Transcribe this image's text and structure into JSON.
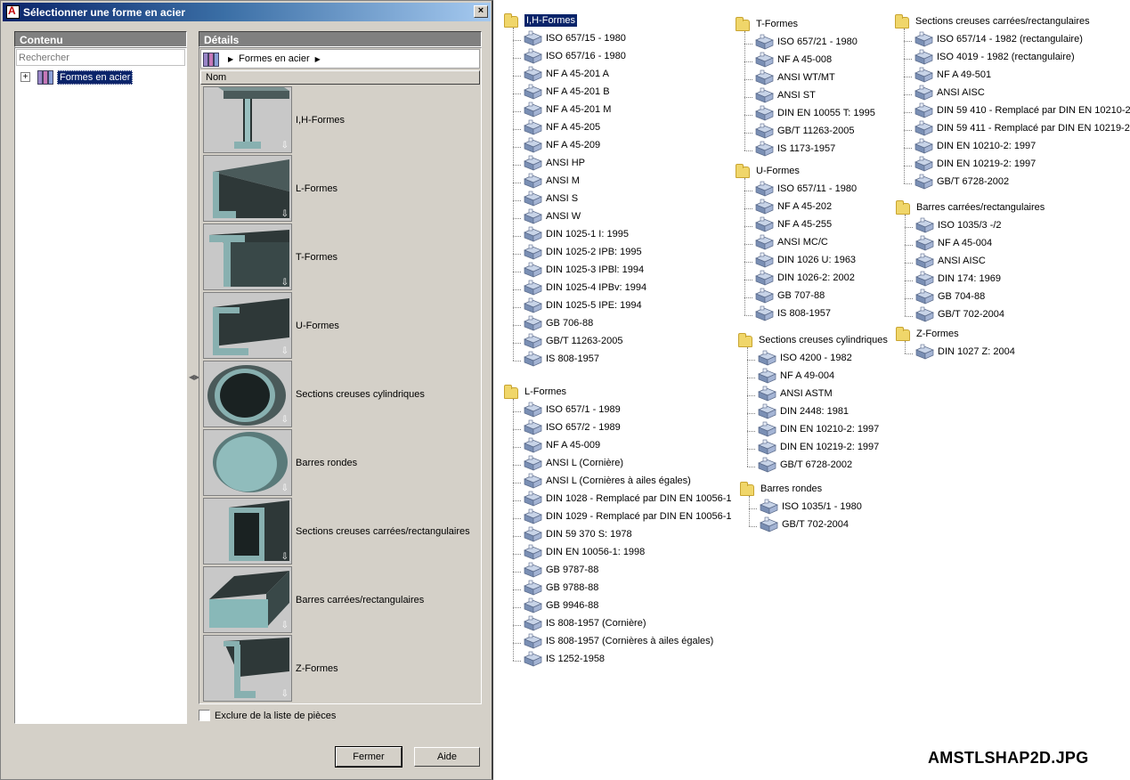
{
  "dialog": {
    "title": "Sélectionner une forme en acier",
    "close_glyph": "×",
    "contenu_header": "Contenu",
    "details_header": "Détails",
    "search_placeholder": "Rechercher",
    "tree_root_label": "Formes en acier",
    "breadcrumb_label": "Formes en acier",
    "column_name": "Nom",
    "shapes": [
      {
        "label": "I,H-Formes",
        "icon": "i-beam-icon"
      },
      {
        "label": "L-Formes",
        "icon": "angle-icon"
      },
      {
        "label": "T-Formes",
        "icon": "tee-icon"
      },
      {
        "label": "U-Formes",
        "icon": "channel-icon"
      },
      {
        "label": "Sections creuses cylindriques",
        "icon": "pipe-icon"
      },
      {
        "label": "Barres rondes",
        "icon": "round-bar-icon"
      },
      {
        "label": "Sections creuses carrées/rectangulaires",
        "icon": "rect-tube-icon"
      },
      {
        "label": "Barres carrées/rectangulaires",
        "icon": "flat-bar-icon"
      },
      {
        "label": "Z-Formes",
        "icon": "z-section-icon"
      }
    ],
    "exclude_label": "Exclure de la liste de pièces",
    "close_button": "Fermer",
    "help_button": "Aide"
  },
  "trees": [
    {
      "title": "I,H-Formes",
      "items": [
        "ISO 657/15 - 1980",
        "ISO 657/16 - 1980",
        "NF A 45-201  A",
        "NF A 45-201  B",
        "NF A 45-201  M",
        "NF A 45-205",
        "NF A 45-209",
        "ANSI HP",
        "ANSI M",
        "ANSI S",
        "ANSI W",
        "DIN 1025-1  I: 1995",
        "DIN 1025-2  IPB: 1995",
        "DIN 1025-3  IPBl: 1994",
        "DIN 1025-4  IPBv: 1994",
        "DIN 1025-5  IPE: 1994",
        "GB 706-88",
        "GB/T 11263-2005",
        "IS 808-1957"
      ]
    },
    {
      "title": "L-Formes",
      "items": [
        "ISO 657/1 - 1989",
        "ISO 657/2 - 1989",
        "NF A 45-009",
        "ANSI L  (Cornière)",
        "ANSI L  (Cornières à ailes égales)",
        "DIN 1028 - Remplacé par DIN EN 10056-1",
        "DIN 1029 - Remplacé par DIN EN 10056-1",
        "DIN 59 370  S: 1978",
        "DIN EN 10056-1: 1998",
        "GB 9787-88",
        "GB 9788-88",
        "GB 9946-88",
        "IS 808-1957  (Cornière)",
        "IS 808-1957  (Cornières à ailes égales)",
        "IS 1252-1958"
      ]
    },
    {
      "title": "T-Formes",
      "items": [
        "ISO 657/21 - 1980",
        "NF A 45-008",
        "ANSI WT/MT",
        "ANSI ST",
        "DIN EN 10055  T: 1995",
        "GB/T 11263-2005",
        "IS 1173-1957"
      ]
    },
    {
      "title": "U-Formes",
      "items": [
        "ISO 657/11 - 1980",
        "NF A 45-202",
        "NF A 45-255",
        "ANSI MC/C",
        "DIN 1026  U: 1963",
        "DIN 1026-2: 2002",
        "GB 707-88",
        "IS 808-1957"
      ]
    },
    {
      "title": "Sections creuses cylindriques",
      "items": [
        "ISO 4200 - 1982",
        "NF A 49-004",
        "ANSI ASTM",
        "DIN 2448: 1981",
        "DIN EN 10210-2: 1997",
        "DIN EN 10219-2: 1997",
        "GB/T 6728-2002"
      ]
    },
    {
      "title": "Barres rondes",
      "items": [
        "ISO 1035/1 - 1980",
        "GB/T 702-2004"
      ]
    },
    {
      "title": "Sections creuses carrées/rectangulaires",
      "items": [
        "ISO 657/14 - 1982 (rectangulaire)",
        "ISO 4019 - 1982 (rectangulaire)",
        "NF A 49-501",
        "ANSI AISC",
        "DIN 59 410 - Remplacé par DIN EN 10210-2",
        "DIN 59 411 - Remplacé par DIN EN 10219-2",
        "DIN EN 10210-2: 1997",
        "DIN EN 10219-2: 1997",
        "GB/T 6728-2002"
      ]
    },
    {
      "title": "Barres carrées/rectangulaires",
      "items": [
        "ISO 1035/3 -/2",
        "NF A 45-004",
        "ANSI AISC",
        "DIN 174: 1969",
        "GB 704-88",
        "GB/T 702-2004"
      ]
    },
    {
      "title": "Z-Formes",
      "items": [
        "DIN 1027  Z: 2004"
      ]
    }
  ],
  "caption": "AMSTLSHAP2D.JPG",
  "colors": {
    "selection": "#0a246a",
    "dialog_bg": "#d4d0c8",
    "folder": "#f0d66a"
  }
}
